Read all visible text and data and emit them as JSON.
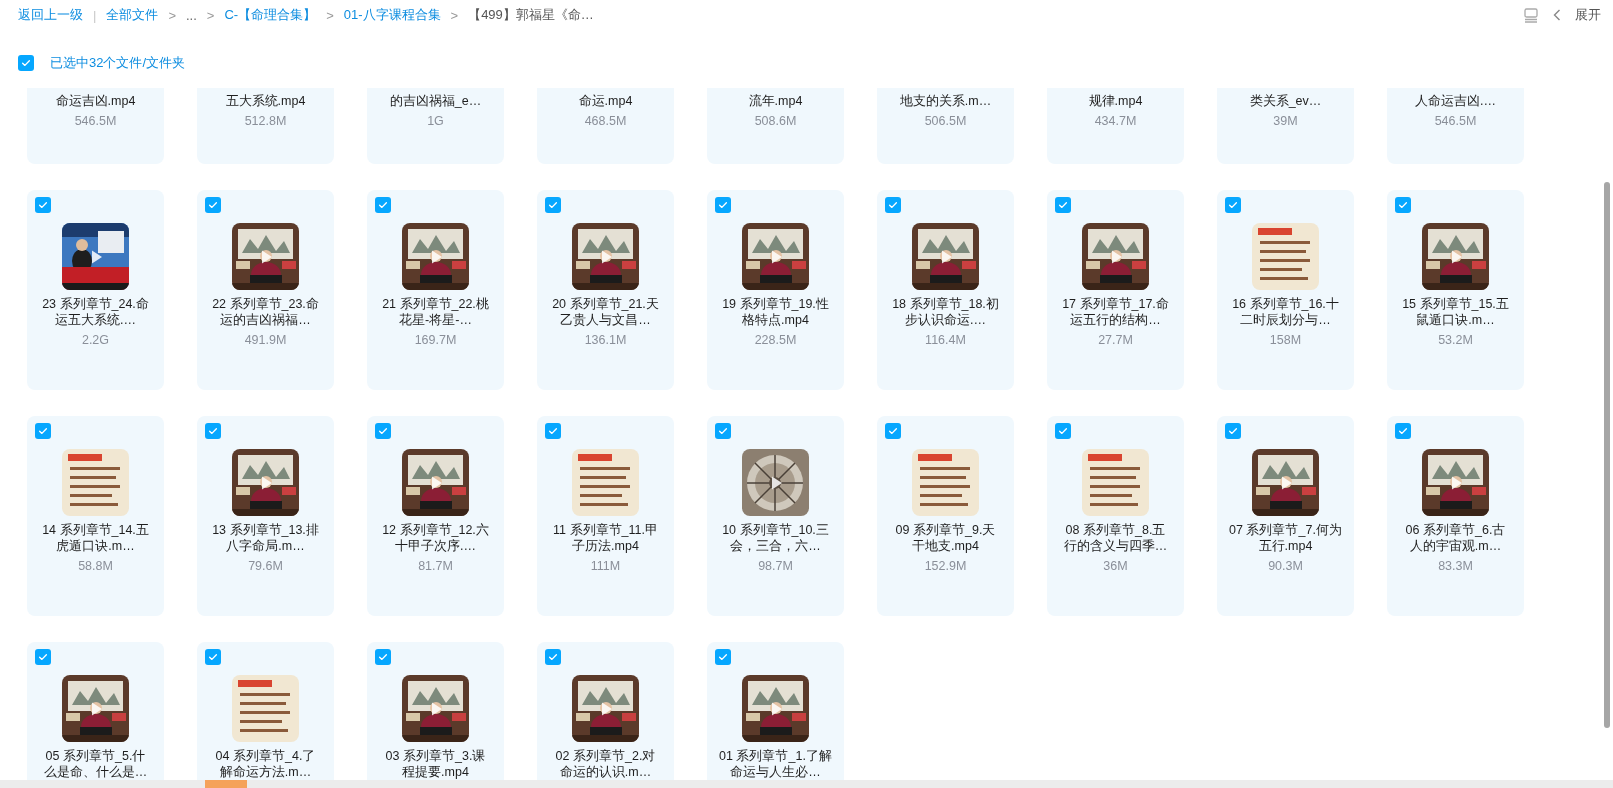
{
  "breadcrumb": {
    "back": "返回上一级",
    "separator": "|",
    "items": [
      {
        "label": "全部文件",
        "kind": "link"
      },
      {
        "label": ">",
        "kind": "arrow"
      },
      {
        "label": "...",
        "kind": "plain"
      },
      {
        "label": ">",
        "kind": "arrow"
      },
      {
        "label": "C-【命理合集】",
        "kind": "link"
      },
      {
        "label": ">",
        "kind": "arrow"
      },
      {
        "label": "01-八字课程合集",
        "kind": "link"
      },
      {
        "label": ">",
        "kind": "arrow"
      },
      {
        "label": "【499】郭福星《命…",
        "kind": "current"
      }
    ]
  },
  "expand": {
    "label": "展开"
  },
  "selection": {
    "checked": true,
    "label": "已选中32个文件/文件夹"
  },
  "clipped_row": [
    {
      "name": "命运吉凶.mp4",
      "size": "546.5M"
    },
    {
      "name": "五大系统.mp4",
      "size": "512.8M"
    },
    {
      "name": "的吉凶祸福_e…",
      "size": "1G"
    },
    {
      "name": "命运.mp4",
      "size": "468.5M"
    },
    {
      "name": "流年.mp4",
      "size": "508.6M"
    },
    {
      "name": "地支的关系.m…",
      "size": "506.5M"
    },
    {
      "name": "规律.mp4",
      "size": "434.7M"
    },
    {
      "name": "类关系_ev…",
      "size": "39M"
    },
    {
      "name": "人命运吉凶.…",
      "size": "546.5M"
    }
  ],
  "files": [
    {
      "name_lines": [
        "23 系列章节_24.命",
        "运五大系统.…"
      ],
      "size": "2.2G",
      "selected": true,
      "kind": "studio"
    },
    {
      "name_lines": [
        "22 系列章节_23.命",
        "运的吉凶祸福…"
      ],
      "size": "491.9M",
      "selected": true,
      "kind": "lecture"
    },
    {
      "name_lines": [
        "21 系列章节_22.桃",
        "花星-将星-…"
      ],
      "size": "169.7M",
      "selected": true,
      "kind": "lecture"
    },
    {
      "name_lines": [
        "20 系列章节_21.天",
        "乙贵人与文昌…"
      ],
      "size": "136.1M",
      "selected": true,
      "kind": "lecture"
    },
    {
      "name_lines": [
        "19 系列章节_19.性",
        "格特点.mp4"
      ],
      "size": "228.5M",
      "selected": true,
      "kind": "lecture"
    },
    {
      "name_lines": [
        "18 系列章节_18.初",
        "步认识命运.…"
      ],
      "size": "116.4M",
      "selected": true,
      "kind": "lecture"
    },
    {
      "name_lines": [
        "17 系列章节_17.命",
        "运五行的结构…"
      ],
      "size": "27.7M",
      "selected": true,
      "kind": "lecture"
    },
    {
      "name_lines": [
        "16 系列章节_16.十",
        "二时辰划分与…"
      ],
      "size": "158M",
      "selected": true,
      "kind": "slide"
    },
    {
      "name_lines": [
        "15 系列章节_15.五",
        "鼠遁口诀.m…"
      ],
      "size": "53.2M",
      "selected": true,
      "kind": "lecture"
    },
    {
      "name_lines": [
        "14 系列章节_14.五",
        "虎遁口诀.m…"
      ],
      "size": "58.8M",
      "selected": true,
      "kind": "slide"
    },
    {
      "name_lines": [
        "13 系列章节_13.排",
        "八字命局.m…"
      ],
      "size": "79.6M",
      "selected": true,
      "kind": "lecture"
    },
    {
      "name_lines": [
        "12 系列章节_12.六",
        "十甲子次序.…"
      ],
      "size": "81.7M",
      "selected": true,
      "kind": "lecture"
    },
    {
      "name_lines": [
        "11 系列章节_11.甲",
        "子历法.mp4"
      ],
      "size": "111M",
      "selected": true,
      "kind": "slide"
    },
    {
      "name_lines": [
        "10 系列章节_10.三",
        "会，三合，六…"
      ],
      "size": "98.7M",
      "selected": true,
      "kind": "dial"
    },
    {
      "name_lines": [
        "09 系列章节_9.天",
        "干地支.mp4"
      ],
      "size": "152.9M",
      "selected": true,
      "kind": "slide"
    },
    {
      "name_lines": [
        "08 系列章节_8.五",
        "行的含义与四季…"
      ],
      "size": "36M",
      "selected": true,
      "kind": "slide"
    },
    {
      "name_lines": [
        "07 系列章节_7.何为",
        "五行.mp4"
      ],
      "size": "90.3M",
      "selected": true,
      "kind": "lecture"
    },
    {
      "name_lines": [
        "06 系列章节_6.古",
        "人的宇宙观.m…"
      ],
      "size": "83.3M",
      "selected": true,
      "kind": "lecture"
    },
    {
      "name_lines": [
        "05 系列章节_5.什",
        "么是命、什么是…"
      ],
      "selected": true,
      "kind": "lecture"
    },
    {
      "name_lines": [
        "04 系列章节_4.了",
        "解命运方法.m…"
      ],
      "selected": true,
      "kind": "slide"
    },
    {
      "name_lines": [
        "03 系列章节_3.课",
        "程提要.mp4"
      ],
      "selected": true,
      "kind": "lecture"
    },
    {
      "name_lines": [
        "02 系列章节_2.对",
        "命运的认识.m…"
      ],
      "selected": true,
      "kind": "lecture"
    },
    {
      "name_lines": [
        "01 系列章节_1.了解",
        "命运与人生必…"
      ],
      "selected": true,
      "kind": "lecture"
    }
  ]
}
